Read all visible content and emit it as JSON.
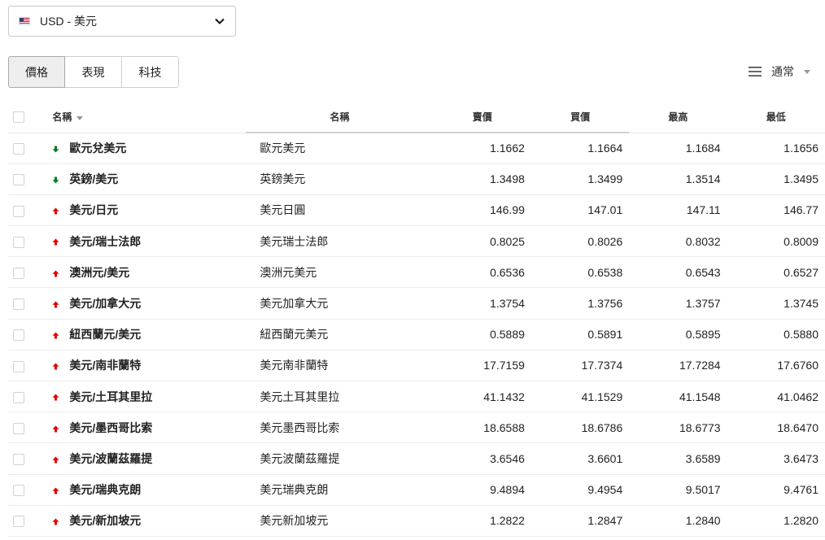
{
  "currency_select": {
    "label": "USD - 美元",
    "flag_icon": "us-flag-icon"
  },
  "tabs": [
    {
      "label": "價格",
      "active": true
    },
    {
      "label": "表現",
      "active": false
    },
    {
      "label": "科技",
      "active": false
    }
  ],
  "view_control": {
    "label": "通常",
    "icon": "menu-lines-icon"
  },
  "table": {
    "headers": {
      "symbol": "名稱",
      "description": "名稱",
      "bid": "賣價",
      "ask": "買價",
      "high": "最高",
      "low": "最低"
    },
    "colors": {
      "up": "#e00000",
      "down": "#0a7a28"
    },
    "rows": [
      {
        "symbol": "歐元兌美元",
        "description": "歐元美元",
        "direction": "down",
        "bid": "1.1662",
        "ask": "1.1664",
        "high": "1.1684",
        "low": "1.1656"
      },
      {
        "symbol": "英鎊/美元",
        "description": "英鎊美元",
        "direction": "down",
        "bid": "1.3498",
        "ask": "1.3499",
        "high": "1.3514",
        "low": "1.3495"
      },
      {
        "symbol": "美元/日元",
        "description": "美元日圓",
        "direction": "up",
        "bid": "146.99",
        "ask": "147.01",
        "high": "147.11",
        "low": "146.77"
      },
      {
        "symbol": "美元/瑞士法郎",
        "description": "美元瑞士法郎",
        "direction": "up",
        "bid": "0.8025",
        "ask": "0.8026",
        "high": "0.8032",
        "low": "0.8009"
      },
      {
        "symbol": "澳洲元/美元",
        "description": "澳洲元美元",
        "direction": "up",
        "bid": "0.6536",
        "ask": "0.6538",
        "high": "0.6543",
        "low": "0.6527"
      },
      {
        "symbol": "美元/加拿大元",
        "description": "美元加拿大元",
        "direction": "up",
        "bid": "1.3754",
        "ask": "1.3756",
        "high": "1.3757",
        "low": "1.3745"
      },
      {
        "symbol": "紐西蘭元/美元",
        "description": "紐西蘭元美元",
        "direction": "up",
        "bid": "0.5889",
        "ask": "0.5891",
        "high": "0.5895",
        "low": "0.5880"
      },
      {
        "symbol": "美元/南非蘭特",
        "description": "美元南非蘭特",
        "direction": "up",
        "bid": "17.7159",
        "ask": "17.7374",
        "high": "17.7284",
        "low": "17.6760"
      },
      {
        "symbol": "美元/土耳其里拉",
        "description": "美元土耳其里拉",
        "direction": "up",
        "bid": "41.1432",
        "ask": "41.1529",
        "high": "41.1548",
        "low": "41.0462"
      },
      {
        "symbol": "美元/墨西哥比索",
        "description": "美元墨西哥比索",
        "direction": "up",
        "bid": "18.6588",
        "ask": "18.6786",
        "high": "18.6773",
        "low": "18.6470"
      },
      {
        "symbol": "美元/波蘭茲羅提",
        "description": "美元波蘭茲羅提",
        "direction": "up",
        "bid": "3.6546",
        "ask": "3.6601",
        "high": "3.6589",
        "low": "3.6473"
      },
      {
        "symbol": "美元/瑞典克朗",
        "description": "美元瑞典克朗",
        "direction": "up",
        "bid": "9.4894",
        "ask": "9.4954",
        "high": "9.5017",
        "low": "9.4761"
      },
      {
        "symbol": "美元/新加坡元",
        "description": "美元新加坡元",
        "direction": "up",
        "bid": "1.2822",
        "ask": "1.2847",
        "high": "1.2840",
        "low": "1.2820"
      }
    ]
  }
}
